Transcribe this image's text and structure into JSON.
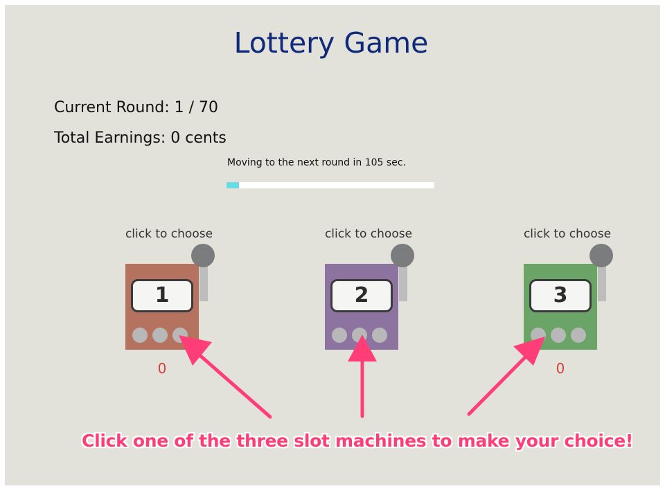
{
  "game": {
    "title": "Lottery Game",
    "round_text": "Current Round: 1 / 70",
    "earnings_text": "Total Earnings: 0 cents",
    "timer_text": "Moving to the next round in 105 sec.",
    "timer_progress_percent": 6,
    "progress_color": "#6adbe4"
  },
  "machines": [
    {
      "choose_label": "click to choose",
      "number": "1",
      "score": "0",
      "color": "#b5725e"
    },
    {
      "choose_label": "click to choose",
      "number": "2",
      "score": "",
      "color": "#8c73a0"
    },
    {
      "choose_label": "click to choose",
      "number": "3",
      "score": "0",
      "color": "#6aa467"
    }
  ],
  "annotation": {
    "text": "Click one of the three slot machines to make your choice!",
    "color": "#ff3e78"
  }
}
